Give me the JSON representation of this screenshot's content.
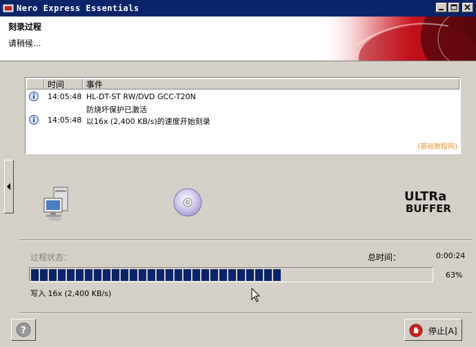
{
  "window": {
    "title": "Nero Express Essentials"
  },
  "header": {
    "title": "刻录过程",
    "subtitle": "请稍候..."
  },
  "log": {
    "columns": [
      "时间",
      "事件"
    ],
    "rows": [
      {
        "icon": "info-icon",
        "time": "14:05:48",
        "event": "HL-DT-ST RW/DVD GCC-T20N"
      },
      {
        "icon": "",
        "time": "",
        "event": "防烧坏保护已激活"
      },
      {
        "icon": "info-icon",
        "time": "14:05:48",
        "event": "以16x (2,400 KB/s)的速度开始刻录"
      }
    ],
    "watermark": "(基础教程网)"
  },
  "status": {
    "label": "过程状态：",
    "total_time_label": "总时间：",
    "total_time": "0:00:24",
    "progress_percent": 63,
    "percent_text": "63%",
    "speed_text": "写入 16x (2,400 KB/s)"
  },
  "buttons": {
    "stop_label": "停止[A]"
  },
  "colors": {
    "titlebar": "#0a246a",
    "progress": "#0a246a",
    "stop_icon": "#d0201a"
  }
}
